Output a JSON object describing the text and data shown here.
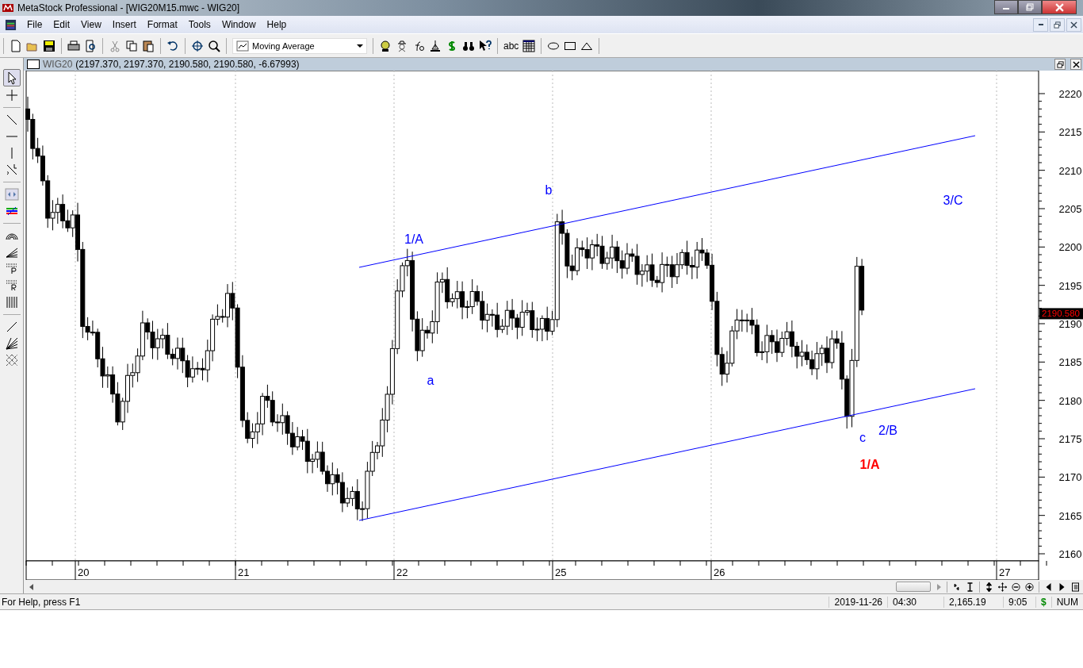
{
  "window": {
    "title": "MetaStock Professional - [WIG20M15.mwc - WIG20]"
  },
  "menu": [
    "File",
    "Edit",
    "View",
    "Insert",
    "Format",
    "Tools",
    "Window",
    "Help"
  ],
  "toolbar": {
    "indicator_dropdown": {
      "value": "Moving Average"
    },
    "text_tool": "abc"
  },
  "chart_window": {
    "title": "WIG20",
    "values": "(2197.370, 2197.370, 2190.580, 2190.580, -6.67993)"
  },
  "chart": {
    "y_ticks": [
      "2220",
      "2215",
      "2210",
      "2205",
      "2200",
      "2195",
      "2190",
      "2185",
      "2180",
      "2175",
      "2170",
      "2165",
      "2160"
    ],
    "x_ticks": [
      "20",
      "21",
      "22",
      "25",
      "26",
      "27"
    ],
    "last_price": "2190.580",
    "annotations": [
      {
        "text": "1/A",
        "color": "#0000ff",
        "bold": false
      },
      {
        "text": "b",
        "color": "#0000ff",
        "bold": false
      },
      {
        "text": "3/C",
        "color": "#0000ff",
        "bold": false
      },
      {
        "text": "a",
        "color": "#0000ff",
        "bold": false
      },
      {
        "text": "c",
        "color": "#0000ff",
        "bold": false
      },
      {
        "text": "2/B",
        "color": "#0000ff",
        "bold": false
      },
      {
        "text": "1/A",
        "color": "#ff0000",
        "bold": true
      }
    ]
  },
  "status_bar": {
    "help": "For Help, press F1",
    "date": "2019-11-26",
    "time": "04:30",
    "value": "2,165.19",
    "clock": "9:05",
    "currency": "$",
    "num": "NUM"
  }
}
